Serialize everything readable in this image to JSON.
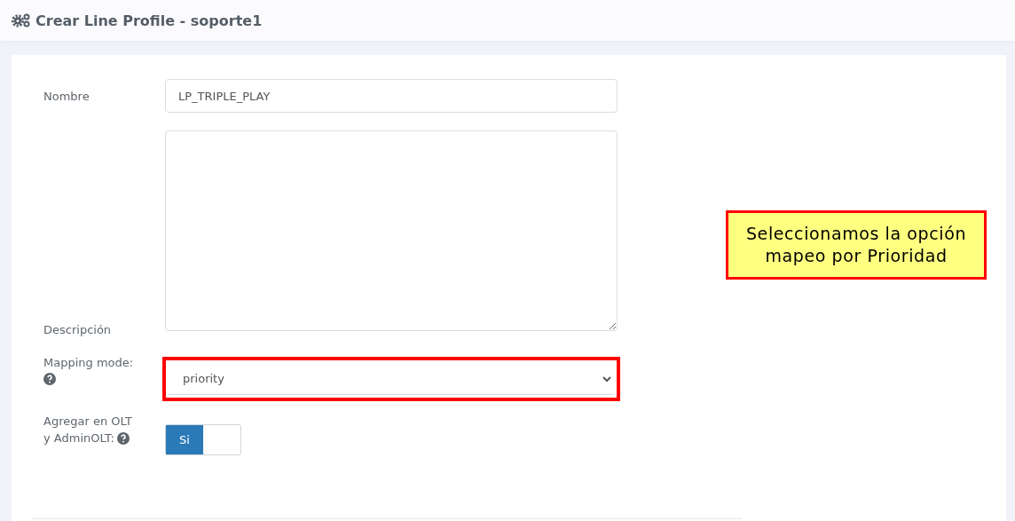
{
  "header": {
    "title": "Crear Line Profile - soporte1"
  },
  "form": {
    "name": {
      "label": "Nombre",
      "value": "LP_TRIPLE_PLAY"
    },
    "description": {
      "label": "Descripción"
    },
    "mapping_mode": {
      "label": "Mapping mode:",
      "value": "priority",
      "highlighted": true
    },
    "add_to_olt": {
      "label_lines": [
        "Agregar en OLT",
        "y AdminOLT:"
      ],
      "toggle_label": "Si",
      "on": true
    }
  },
  "callout": {
    "lines": [
      "Seleccionamos la opción",
      "mapeo por Prioridad"
    ]
  }
}
